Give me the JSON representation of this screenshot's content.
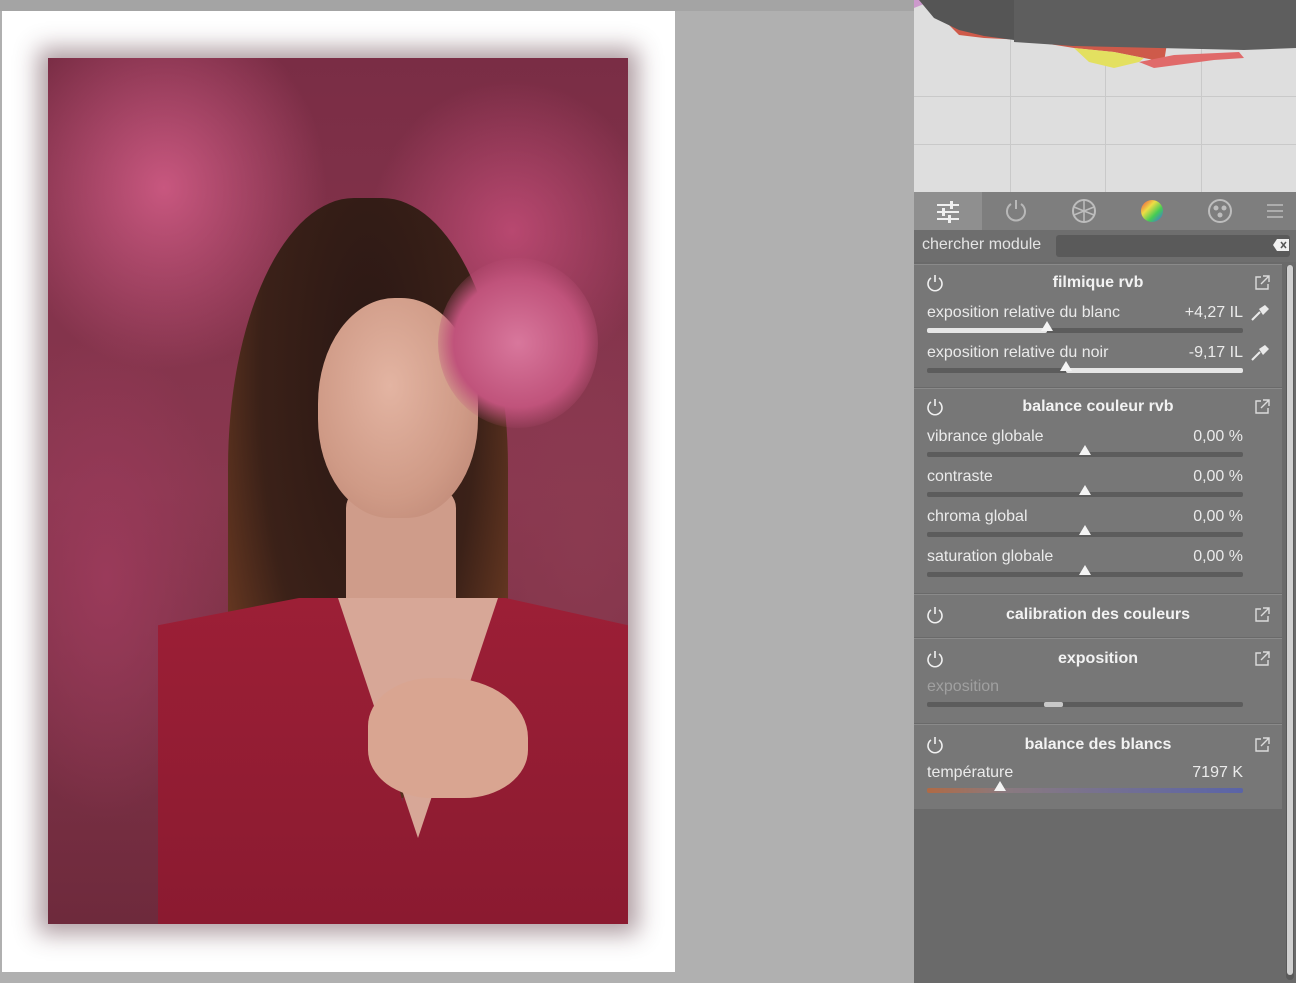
{
  "panel": {
    "search": {
      "label": "chercher module",
      "placeholder": ""
    },
    "tabs": [
      {
        "icon": "sliders-icon",
        "active": true
      },
      {
        "icon": "power-icon",
        "active": false
      },
      {
        "icon": "aperture-icon",
        "active": false
      },
      {
        "icon": "color-wheel-icon",
        "active": false
      },
      {
        "icon": "effects-icon",
        "active": false
      },
      {
        "icon": "menu-icon",
        "active": false
      }
    ]
  },
  "modules": {
    "filmic": {
      "title": "filmique rvb",
      "params": [
        {
          "label": "exposition relative du blanc",
          "value": "+4,27 IL",
          "position": 0.38
        },
        {
          "label": "exposition relative du noir",
          "value": "-9,17 IL",
          "position": 0.44
        }
      ]
    },
    "colorbalance": {
      "title": "balance couleur rvb",
      "params": [
        {
          "label": "vibrance globale",
          "value": "0,00 %",
          "position": 0.5
        },
        {
          "label": "contraste",
          "value": "0,00 %",
          "position": 0.5
        },
        {
          "label": "chroma global",
          "value": "0,00 %",
          "position": 0.5
        },
        {
          "label": "saturation globale",
          "value": "0,00 %",
          "position": 0.5
        }
      ]
    },
    "calibration": {
      "title": "calibration des couleurs"
    },
    "exposure": {
      "title": "exposition",
      "params": [
        {
          "label": "exposition",
          "value": "",
          "position": 0.42
        }
      ]
    },
    "whitebalance": {
      "title": "balance des blancs",
      "params": [
        {
          "label": "température",
          "value": "7197 K",
          "position": 0.23
        }
      ]
    }
  },
  "colors": {
    "panel_bg": "#6a6a6a",
    "module_bg": "#777777",
    "text": "#ebebeb",
    "canvas_bg": "#b0b0b0"
  }
}
